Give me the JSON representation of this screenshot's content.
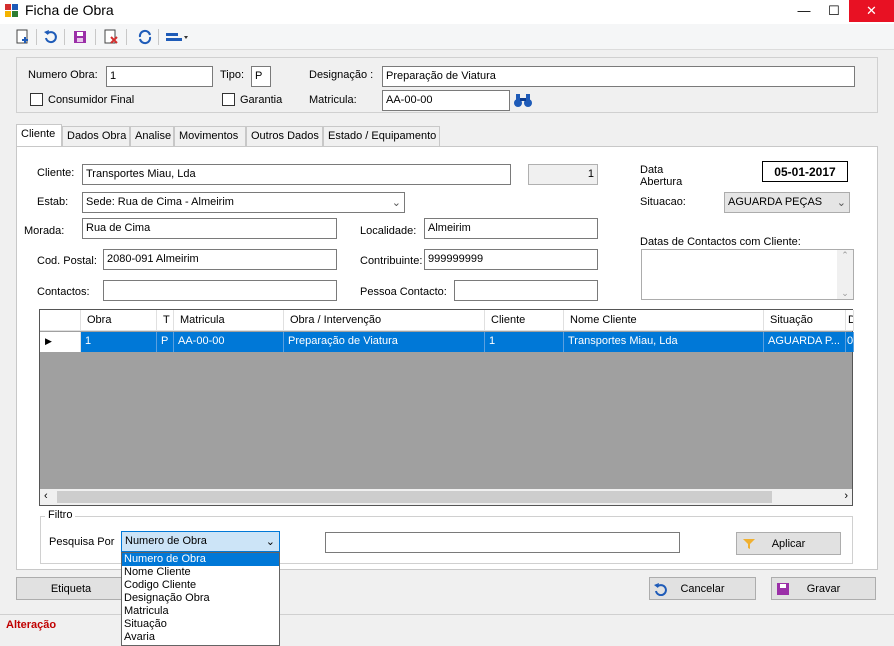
{
  "window": {
    "title": "Ficha de Obra",
    "minimize": "—",
    "maximize": "☐",
    "close": "✕"
  },
  "header": {
    "numero_obra_label": "Numero Obra:",
    "numero_obra_value": "1",
    "tipo_label": "Tipo:",
    "tipo_value": "P",
    "designacao_label": "Designação :",
    "designacao_value": "Preparação de Viatura",
    "consumidor_final_label": "Consumidor Final",
    "garantia_label": "Garantia",
    "matricula_label": "Matricula:",
    "matricula_value": "AA-00-00"
  },
  "tabs": [
    {
      "label": "Cliente"
    },
    {
      "label": "Dados Obra"
    },
    {
      "label": "Analise"
    },
    {
      "label": "Movimentos"
    },
    {
      "label": "Outros Dados"
    },
    {
      "label": "Estado / Equipamento"
    }
  ],
  "cliente": {
    "cliente_label": "Cliente:",
    "cliente_value": "Transportes Miau, Lda",
    "cliente_num": "1",
    "estab_label": "Estab:",
    "estab_value": "Sede: Rua de Cima - Almeirim",
    "morada_label": "Morada:",
    "morada_value": "Rua de Cima",
    "localidade_label": "Localidade:",
    "localidade_value": "Almeirim",
    "cod_postal_label": "Cod. Postal:",
    "cod_postal_value": "2080-091 Almeirim",
    "contribuinte_label": "Contribuinte:",
    "contribuinte_value": "999999999",
    "contactos_label": "Contactos:",
    "contactos_value": "",
    "pessoa_contacto_label": "Pessoa Contacto:",
    "pessoa_contacto_value": "",
    "data_label_1": "Data",
    "data_label_2": "Abertura",
    "data_value": "05-01-2017",
    "situacao_label": "Situacao:",
    "situacao_value": "AGUARDA PEÇAS",
    "datas_contactos_label": "Datas de Contactos com Cliente:"
  },
  "grid": {
    "columns": [
      "Obra",
      "T",
      "Matricula",
      "Obra / Intervenção",
      "Cliente",
      "Nome Cliente",
      "Situação",
      "D"
    ],
    "rows": [
      {
        "obra": "1",
        "t": "P",
        "matricula": "AA-00-00",
        "intervencao": "Preparação de Viatura",
        "cliente": "1",
        "nome": "Transportes Miau, Lda",
        "situacao": "AGUARDA P...",
        "d": "0"
      }
    ]
  },
  "filtro": {
    "legend": "Filtro",
    "pesquisa_label": "Pesquisa Por",
    "pesquisa_value": "Numero de Obra",
    "search_value": "",
    "aplicar_label": "Aplicar",
    "options": [
      "Numero de Obra",
      "Nome Cliente",
      "Codigo Cliente",
      "Designação Obra",
      "Matricula",
      "Situação",
      "Avaria"
    ]
  },
  "buttons": {
    "etiqueta": "Etiqueta",
    "cancelar": "Cancelar",
    "gravar": "Gravar"
  },
  "status": {
    "text": "Alteração"
  },
  "colors": {
    "selection": "#0078d7",
    "close_button": "#e81123",
    "status_text": "#c00000"
  }
}
